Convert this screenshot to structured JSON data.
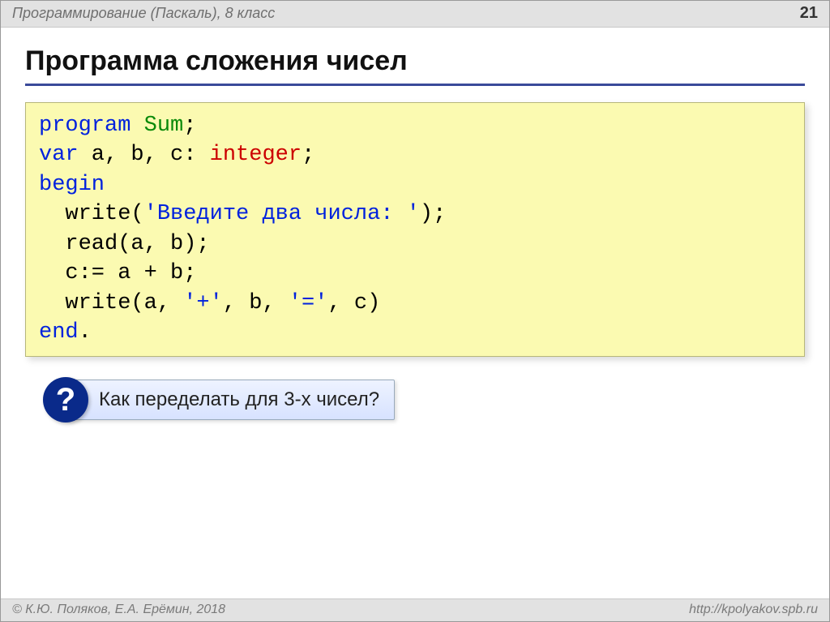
{
  "header": {
    "course_title": "Программирование (Паскаль), 8 класс",
    "page_number": "21"
  },
  "title": "Программа сложения чисел",
  "code": {
    "kw_program": "program",
    "prog_name": "Sum",
    "semi": ";",
    "kw_var": "var",
    "var_decl": " a, b, c: ",
    "kw_integer": "integer",
    "kw_begin": "begin",
    "line_write1_a": "  write(",
    "str_prompt": "'Введите два числа: '",
    "line_write1_b": ");",
    "line_read": "  read(a, b);",
    "line_assign": "  c:= a + b;",
    "line_write2_a": "  write(a, ",
    "str_plus": "'+'",
    "line_write2_b": ", b, ",
    "str_eq": "'='",
    "line_write2_c": ", c)",
    "kw_end": "end",
    "dot": "."
  },
  "callout": {
    "question_mark": "?",
    "text": "Как переделать для 3-х чисел?"
  },
  "footer": {
    "copyright": "© К.Ю. Поляков, Е.А. Ерёмин, 2018",
    "url": "http://kpolyakov.spb.ru"
  }
}
